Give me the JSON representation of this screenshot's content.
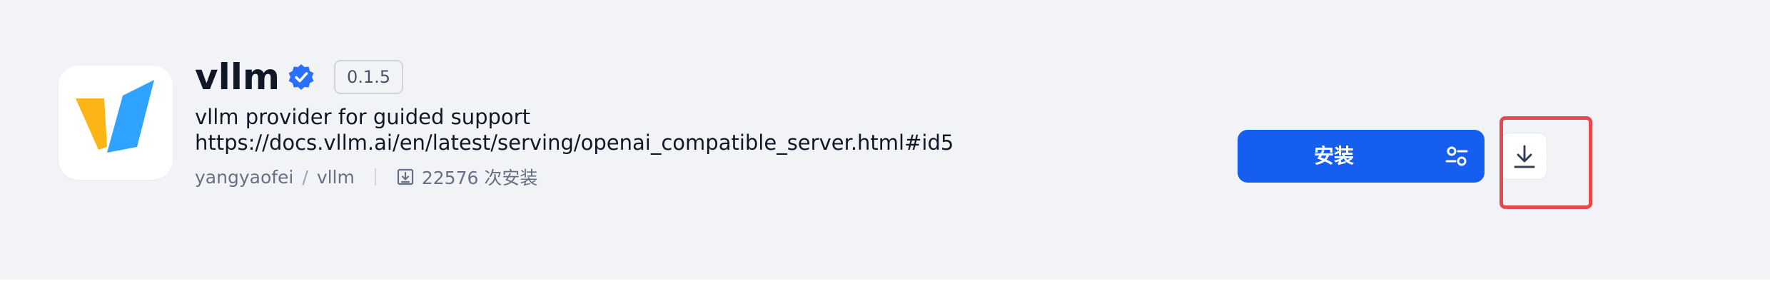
{
  "plugin": {
    "name": "vllm",
    "version": "0.1.5",
    "description": "vllm provider for guided support",
    "doc_link": "https://docs.vllm.ai/en/latest/serving/openai_compatible_server.html#id5",
    "author": "yangyaofei",
    "repo": "vllm",
    "installs": "22576 次安装"
  },
  "actions": {
    "install_label": "安装"
  },
  "icons": {
    "logo": "vllm-logo-icon",
    "verified": "verified-badge-icon",
    "install_count": "download-count-icon",
    "install_options": "sliders-icon",
    "download": "download-icon"
  },
  "colors": {
    "primary": "#155eef",
    "highlight": "#e5484d",
    "logo_yellow": "#fdb515",
    "logo_blue": "#30a2ff"
  }
}
